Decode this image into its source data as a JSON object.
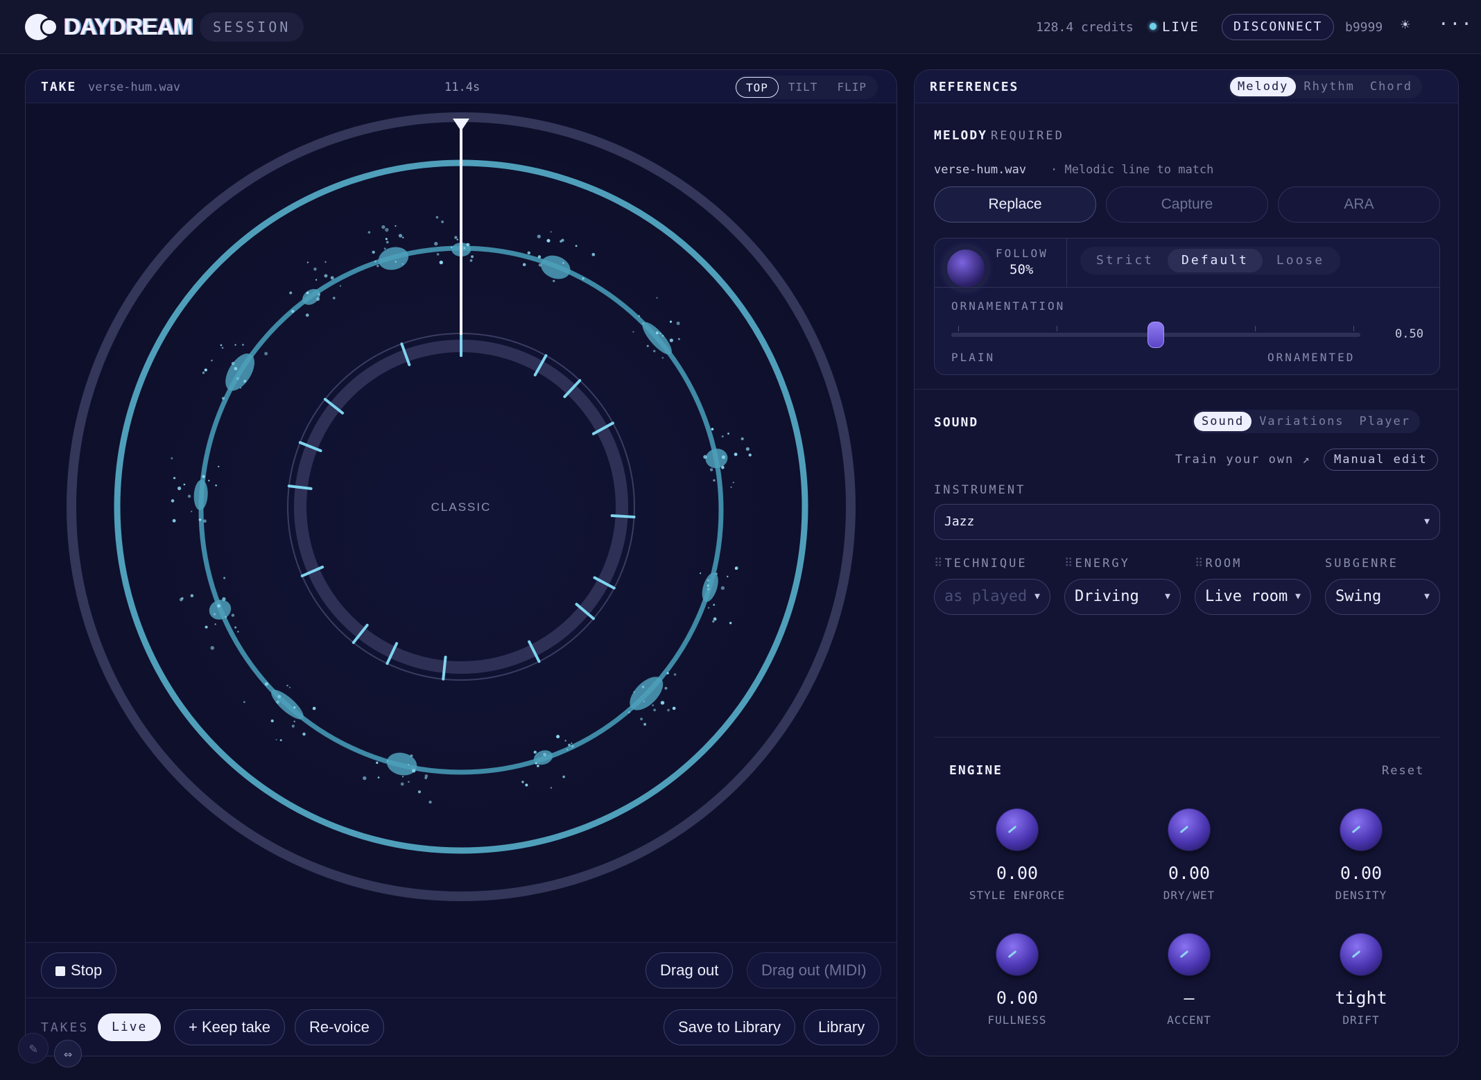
{
  "topbar": {
    "brand": "DAYDREAM",
    "session": "SESSION",
    "credits": "128.4 credits",
    "live": "LIVE",
    "disconnect": "DISCONNECT",
    "user": "b9999",
    "theme_icon": "sun-icon",
    "menu_icon": "more-icon"
  },
  "take": {
    "label": "TAKE",
    "file": "verse-hum.wav",
    "duration": "11.4s",
    "views": [
      "TOP",
      "TILT",
      "FLIP"
    ],
    "active_view": "TOP",
    "center_label": "CLASSIC"
  },
  "transport": {
    "stop": "Stop",
    "drag_out": "Drag out",
    "drag_out_midi": "Drag out (MIDI)"
  },
  "takes": {
    "label": "TAKES",
    "live": "Live",
    "keep": "+ Keep take",
    "revoice": "Re-voice",
    "save": "Save to Library",
    "library": "Library"
  },
  "references": {
    "title": "REFERENCES",
    "tabs": [
      "Melody",
      "Rhythm",
      "Chord"
    ],
    "active_tab": "Melody",
    "melody": {
      "title": "MELODY",
      "required": "REQUIRED",
      "file": "verse-hum.wav",
      "desc": "· Melodic line to match",
      "modes": [
        "Replace",
        "Capture",
        "ARA"
      ],
      "active_mode": "Replace",
      "follow_label": "FOLLOW",
      "follow_value": "50%",
      "follow_modes": [
        "Strict",
        "Default",
        "Loose"
      ],
      "active_follow": "Default",
      "ornamentation_label": "ORNAMENTATION",
      "ornamentation_value": "0.50",
      "ornamentation_fraction": 0.5,
      "plain": "PLAIN",
      "ornamented": "ORNAMENTED"
    }
  },
  "sound": {
    "title": "SOUND",
    "tabs": [
      "Sound",
      "Variations",
      "Player"
    ],
    "active_tab": "Sound",
    "train": "Train your own ↗",
    "manual_edit": "Manual edit",
    "instrument_label": "INSTRUMENT",
    "instrument": "Jazz",
    "technique_label": "TECHNIQUE",
    "technique": "as played",
    "energy_label": "ENERGY",
    "energy": "Driving",
    "room_label": "ROOM",
    "room": "Live room",
    "subgenre_label": "SUBGENRE",
    "subgenre": "Swing"
  },
  "engine": {
    "title": "ENGINE",
    "reset": "Reset",
    "knobs": [
      {
        "value": "0.00",
        "label": "STYLE ENFORCE"
      },
      {
        "value": "0.00",
        "label": "DRY/WET"
      },
      {
        "value": "0.00",
        "label": "DENSITY"
      },
      {
        "value": "0.00",
        "label": "FULLNESS"
      },
      {
        "value": "–",
        "label": "ACCENT"
      },
      {
        "value": "tight",
        "label": "DRIFT"
      }
    ]
  },
  "colors": {
    "background": "#0f1029",
    "panel": "#111232",
    "accent_teal": "#4fa3bf",
    "accent_violet": "#6b52d6",
    "text": "#eef0ff"
  }
}
